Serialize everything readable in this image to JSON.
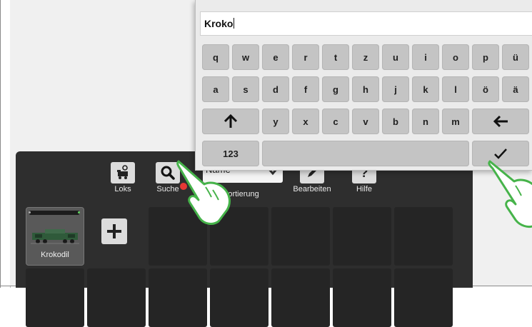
{
  "keyboard": {
    "input_value": "Kroko",
    "row1": [
      "q",
      "w",
      "e",
      "r",
      "t",
      "z",
      "u",
      "i",
      "o",
      "p",
      "ü"
    ],
    "row2": [
      "a",
      "s",
      "d",
      "f",
      "g",
      "h",
      "j",
      "k",
      "l",
      "ö",
      "ä"
    ],
    "row3": [
      "y",
      "x",
      "c",
      "v",
      "b",
      "n",
      "m"
    ],
    "numeric_key": "123"
  },
  "toolbar": {
    "loks_label": "Loks",
    "suche_label": "Suche",
    "sort_value": "Name",
    "sort_label": "Sortierung",
    "bearbeiten_label": "Bearbeiten",
    "hilfe_label": "Hilfe"
  },
  "locos": [
    {
      "name": "Krokodil"
    }
  ],
  "icons": {
    "loks": "locomotive-icon",
    "suche": "search-icon",
    "bearbeiten": "edit-icon",
    "hilfe": "help-icon",
    "add": "plus-icon",
    "shift": "shift-arrow-icon",
    "backspace": "backspace-arrow-icon",
    "confirm": "checkmark-icon"
  },
  "colors": {
    "panel_bg": "#2e2e2e",
    "key_bg": "#c4c4c4",
    "hand_outline": "#46b34a",
    "alert_red": "#e53935"
  }
}
